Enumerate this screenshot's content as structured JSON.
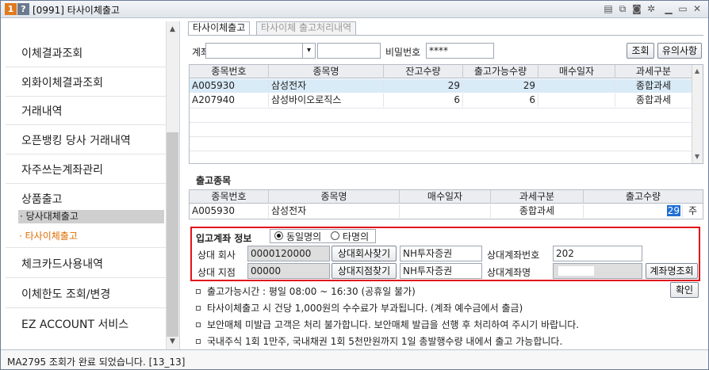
{
  "window": {
    "title": "[0991] 타사이체출고",
    "app_badge": "1",
    "help_badge": "?",
    "toolbar_icons": [
      "note-icon",
      "copy-icon",
      "camera-icon",
      "gear-icon",
      "minimize-icon",
      "close-icon"
    ]
  },
  "sidebar": {
    "items": [
      {
        "label": "이체결과조회"
      },
      {
        "label": "외화이체결과조회"
      },
      {
        "label": "거래내역"
      },
      {
        "label": "오픈뱅킹 당사 거래내역"
      },
      {
        "label": "자주쓰는계좌관리"
      },
      {
        "label": "상품출고"
      },
      {
        "label": "체크카드사용내역"
      },
      {
        "label": "이체한도 조회/변경"
      },
      {
        "label": "EZ ACCOUNT 서비스"
      }
    ],
    "sub_items": [
      {
        "label": "· 당사대체출고"
      },
      {
        "label": "· 타사이체출고"
      }
    ]
  },
  "tabs": [
    {
      "label": "타사이체출고"
    },
    {
      "label": "타사이체 출고처리내역"
    }
  ],
  "account_bar": {
    "account_label": "계좌",
    "account_value": "",
    "account_name": "",
    "password_label": "비밀번호",
    "password_value": "****",
    "search_button": "조회",
    "notice_button": "유의사항"
  },
  "stock_grid": {
    "headers": [
      "종목번호",
      "종목명",
      "잔고수량",
      "출고가능수량",
      "매수일자",
      "과세구분"
    ],
    "rows": [
      {
        "code": "A005930",
        "name": "삼성전자",
        "balance": "29",
        "available": "29",
        "buy_date": "",
        "tax": "종합과세"
      },
      {
        "code": "A207940",
        "name": "삼성바이오로직스",
        "balance": "6",
        "available": "6",
        "buy_date": "",
        "tax": "종합과세"
      }
    ]
  },
  "out_section": {
    "title": "출고종목",
    "headers": [
      "종목번호",
      "종목명",
      "매수일자",
      "과세구분",
      "출고수량"
    ],
    "row": {
      "code": "A005930",
      "name": "삼성전자",
      "buy_date": "",
      "tax": "종합과세",
      "qty": "29",
      "unit": "주"
    }
  },
  "deposit": {
    "title": "입고계좌 정보",
    "radio_same": "동일명의",
    "radio_other": "타명의",
    "company_label": "상대 회사",
    "company_code": "0000120000",
    "company_button": "상대회사찾기",
    "company_name": "NH투자증권",
    "branch_label": "상대 지점",
    "branch_code": "00000",
    "branch_button": "상대지점찾기",
    "branch_name": "NH투자증권",
    "acct_no_label": "상대계좌번호",
    "acct_no_value": "202",
    "acct_name_label": "상대계좌명",
    "acct_name_value": "",
    "acct_name_button": "계좌명조회"
  },
  "confirm_button": "확인",
  "notes": [
    "출고가능시간 : 평일 08:00 ~ 16:30 (공휴일 불가)",
    "타사이체출고 시 건당 1,000원의 수수료가 부과됩니다. (계좌 예수금에서 출금)",
    "보안매체 미발급 고객은 처리 불가합니다. 보안매체 발급을 선행 후 처리하여 주시기 바랍니다.",
    "국내주식 1회 1만주, 국내채권 1회 5천만원까지 1일 총발행수량 내에서 출고 가능합니다."
  ],
  "status": {
    "message": "MA2795 조회가 완료 되었습니다. [13_13]"
  }
}
